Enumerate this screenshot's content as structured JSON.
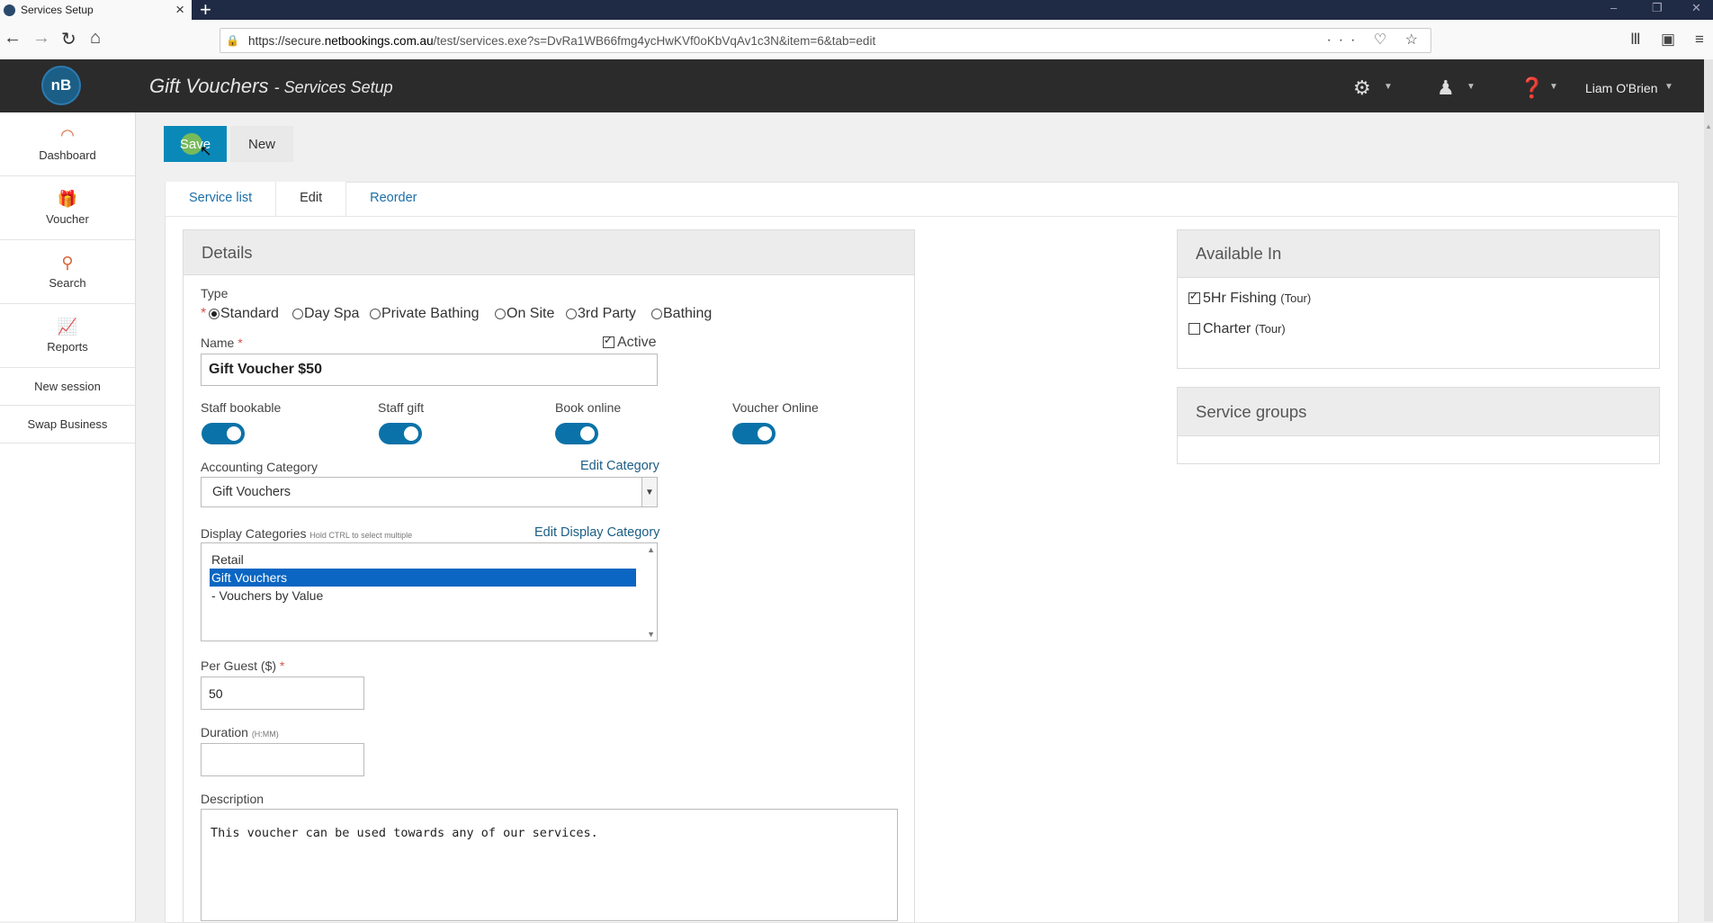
{
  "browser": {
    "tab_title": "Services Setup",
    "url_prefix": "https://secure.",
    "url_host": "netbookings.com.au",
    "url_rest": "/test/services.exe?s=DvRa1WB66fmg4ycHwKVf0oKbVqAv1c3N&item=6&tab=edit"
  },
  "header": {
    "logo_text": "nB",
    "title": "Gift Vouchers",
    "subtitle": "- Services Setup",
    "user_name": "Liam O'Brien"
  },
  "sidebar": {
    "items": [
      {
        "label": "Dashboard",
        "icon": "dashboard-icon"
      },
      {
        "label": "Voucher",
        "icon": "gift-icon"
      },
      {
        "label": "Search",
        "icon": "search-icon"
      },
      {
        "label": "Reports",
        "icon": "chart-icon"
      },
      {
        "label": "New session"
      },
      {
        "label": "Swap Business"
      }
    ]
  },
  "toolbar": {
    "save_label": "Save",
    "new_label": "New"
  },
  "tabs": [
    "Service list",
    "Edit",
    "Reorder"
  ],
  "details": {
    "heading": "Details",
    "type_label": "Type",
    "type_options": [
      "Standard",
      "Day Spa",
      "Private Bathing",
      "On Site",
      "3rd Party",
      "Bathing"
    ],
    "type_selected": "Standard",
    "name_label": "Name",
    "name_value": "Gift Voucher $50",
    "active_label": "Active",
    "active_checked": true,
    "toggles": [
      {
        "label": "Staff bookable",
        "on": true
      },
      {
        "label": "Staff gift",
        "on": true
      },
      {
        "label": "Book online",
        "on": true
      },
      {
        "label": "Voucher Online",
        "on": true
      }
    ],
    "accounting_label": "Accounting Category",
    "accounting_value": "Gift Vouchers",
    "edit_category_link": "Edit Category",
    "display_label": "Display Categories",
    "display_hint": "Hold CTRL to select multiple",
    "edit_display_link": "Edit Display Category",
    "display_options": [
      "Retail",
      "Gift Vouchers",
      "- Vouchers by Value"
    ],
    "display_selected": "Gift Vouchers",
    "per_guest_label": "Per Guest ($)",
    "per_guest_value": "50",
    "duration_label": "Duration",
    "duration_hint": "(H:MM)",
    "duration_value": "",
    "description_label": "Description",
    "description_value": "This voucher can be used towards any of our services."
  },
  "available_in": {
    "heading": "Available In",
    "items": [
      {
        "name": "5Hr Fishing",
        "kind": "(Tour)",
        "checked": true
      },
      {
        "name": "Charter",
        "kind": "(Tour)",
        "checked": false
      }
    ]
  },
  "service_groups": {
    "heading": "Service groups"
  },
  "colors": {
    "header_bg": "#2b2b2b",
    "accent": "#0a89b8",
    "toggle_on": "#0a72a8",
    "sidebar_icon": "#d9663a"
  }
}
